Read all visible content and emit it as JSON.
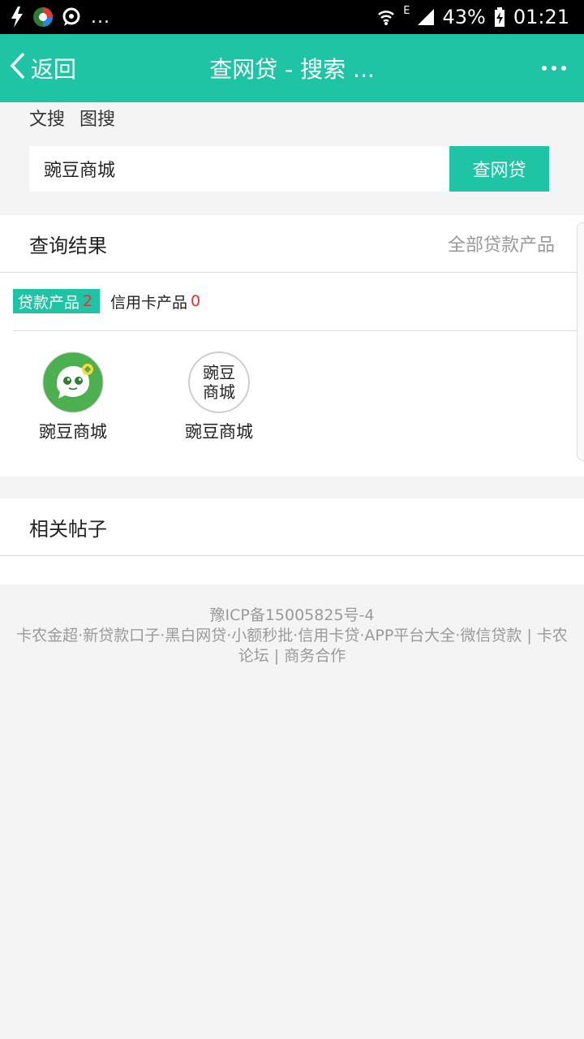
{
  "status_bar": {
    "icons_left": [
      "flash-icon",
      "app-icon",
      "message-icon"
    ],
    "ellipsis": "...",
    "network": "E",
    "battery": "43%",
    "time": "01:21"
  },
  "header": {
    "back_label": "返回",
    "title": "查网贷 - 搜索 ..."
  },
  "search_modes": [
    "文搜",
    "图搜"
  ],
  "search": {
    "value": "豌豆商城",
    "button_label": "查网贷"
  },
  "results": {
    "title": "查询结果",
    "all_link": "全部贷款产品",
    "tabs": [
      {
        "label": "贷款产品",
        "count": "2"
      },
      {
        "label": "信用卡产品",
        "count": "0"
      }
    ],
    "products": [
      {
        "name": "豌豆商城"
      },
      {
        "name": "豌豆商城",
        "logo_text_top": "豌豆",
        "logo_text_bottom": "商城"
      }
    ]
  },
  "posts": {
    "title": "相关帖子"
  },
  "footer": {
    "icp": "豫ICP备15005825号-4",
    "links_line1": "卡农金超·新贷款口子·黑白网贷·小额秒批·信用卡贷·APP平台大全·微信贷款 | 卡农",
    "links_line2": "论坛 | 商务合作"
  },
  "colors": {
    "accent": "#1fc4a4",
    "count_red": "#e3322f",
    "background": "#f4f4f4"
  }
}
